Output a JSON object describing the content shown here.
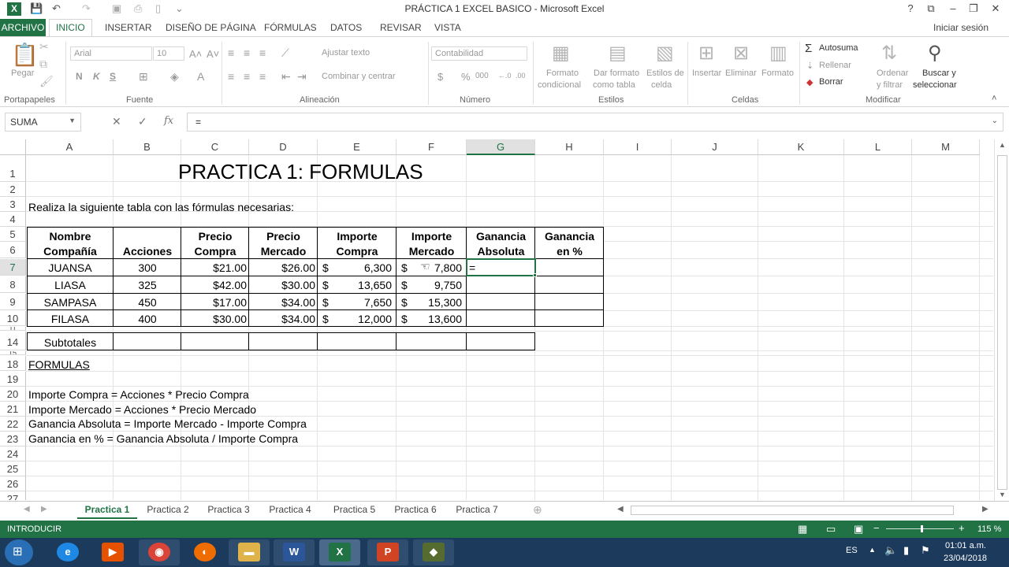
{
  "window": {
    "title": "PRÁCTICA 1 EXCEL BASICO - Microsoft Excel",
    "help": "?",
    "sign_in": "Iniciar sesión"
  },
  "ribbon_tabs": [
    "ARCHIVO",
    "INICIO",
    "INSERTAR",
    "DISEÑO DE PÁGINA",
    "FÓRMULAS",
    "DATOS",
    "REVISAR",
    "VISTA"
  ],
  "ribbon": {
    "paste": "Pegar",
    "font_name": "Arial",
    "font_size": "10",
    "bold": "N",
    "italic": "K",
    "underline": "S",
    "wrap_text": "Ajustar texto",
    "merge_center": "Combinar y centrar",
    "number_format": "Contabilidad",
    "currency": "$",
    "percent": "%",
    "thousands": "000",
    "cond_format": [
      "Formato",
      "condicional"
    ],
    "format_table": [
      "Dar formato",
      "como tabla"
    ],
    "cell_styles": [
      "Estilos de",
      "celda"
    ],
    "insert": "Insertar",
    "delete": "Eliminar",
    "format": "Formato",
    "autosum": "Autosuma",
    "fill": "Rellenar",
    "clear": "Borrar",
    "sort": [
      "Ordenar",
      "y filtrar"
    ],
    "find": [
      "Buscar y",
      "seleccionar"
    ],
    "groups": [
      "Portapapeles",
      "Fuente",
      "Alineación",
      "Número",
      "Estilos",
      "Celdas",
      "Modificar"
    ]
  },
  "formula_bar": {
    "name_box": "SUMA",
    "cancel": "✕",
    "enter": "✓",
    "fx": "fx",
    "formula": "="
  },
  "columns": [
    "A",
    "B",
    "C",
    "D",
    "E",
    "F",
    "G",
    "H",
    "I",
    "J",
    "K",
    "L",
    "M"
  ],
  "rows": [
    "1",
    "2",
    "3",
    "4",
    "5",
    "6",
    "7",
    "8",
    "9",
    "10",
    "11",
    "14",
    "15",
    "18",
    "19",
    "20",
    "21",
    "22",
    "23",
    "24",
    "25",
    "26",
    "27"
  ],
  "sheet": {
    "title": "PRACTICA 1: FORMULAS",
    "instruction": "Realiza la siguiente tabla con las fórmulas necesarias:",
    "headers_row5": [
      "Nombre",
      "",
      "Precio",
      "Precio",
      "Importe",
      "Importe",
      "Ganancia",
      "Ganancia"
    ],
    "headers_row6": [
      "Compañía",
      "Acciones",
      "Compra",
      "Mercado",
      "Compra",
      "Mercado",
      "Absoluta",
      "en %"
    ],
    "currency_symbol": "$",
    "data": [
      {
        "company": "JUANSA",
        "shares": "300",
        "buy_price": "$21.00",
        "market_price": "$26.00",
        "buy_amount": "6,300",
        "market_amount": "7,800",
        "abs_gain": "=",
        "pct_gain": ""
      },
      {
        "company": "LIASA",
        "shares": "325",
        "buy_price": "$42.00",
        "market_price": "$30.00",
        "buy_amount": "13,650",
        "market_amount": "9,750",
        "abs_gain": "",
        "pct_gain": ""
      },
      {
        "company": "SAMPASA",
        "shares": "450",
        "buy_price": "$17.00",
        "market_price": "$34.00",
        "buy_amount": "7,650",
        "market_amount": "15,300",
        "abs_gain": "",
        "pct_gain": ""
      },
      {
        "company": "FILASA",
        "shares": "400",
        "buy_price": "$30.00",
        "market_price": "$34.00",
        "buy_amount": "12,000",
        "market_amount": "13,600",
        "abs_gain": "",
        "pct_gain": ""
      }
    ],
    "subtotals": "Subtotales",
    "formulas_heading": "FORMULAS",
    "formulas": [
      "Importe Compra = Acciones * Precio Compra",
      "Importe Mercado = Acciones * Precio Mercado",
      "Ganancia Absoluta = Importe Mercado - Importe Compra",
      "Ganancia en % = Ganancia Absoluta / Importe Compra"
    ]
  },
  "sheet_tabs": [
    "Practica 1",
    "Practica 2",
    "Practica 3",
    "Practica 4",
    "Practica 5",
    "Practica 6",
    "Practica 7"
  ],
  "status": {
    "mode": "INTRODUCIR",
    "zoom": "115 %"
  },
  "taskbar": {
    "language": "ES",
    "time": "01:01 a.m.",
    "date": "23/04/2018"
  },
  "colors": {
    "excel_green": "#217346",
    "taskbar": "#1c3a5c"
  }
}
